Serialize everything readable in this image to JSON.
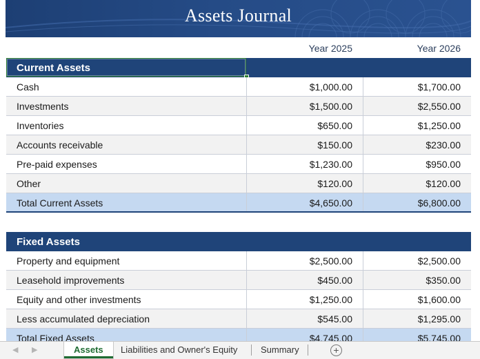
{
  "banner": {
    "title": "Assets Journal"
  },
  "columns": {
    "year1": "Year 2025",
    "year2": "Year 2026"
  },
  "current_assets": {
    "header": "Current Assets",
    "rows": [
      {
        "label": "Cash",
        "y1": "$1,000.00",
        "y2": "$1,700.00"
      },
      {
        "label": "Investments",
        "y1": "$1,500.00",
        "y2": "$2,550.00"
      },
      {
        "label": "Inventories",
        "y1": "$650.00",
        "y2": "$1,250.00"
      },
      {
        "label": "Accounts receivable",
        "y1": "$150.00",
        "y2": "$230.00"
      },
      {
        "label": "Pre-paid expenses",
        "y1": "$1,230.00",
        "y2": "$950.00"
      },
      {
        "label": "Other",
        "y1": "$120.00",
        "y2": "$120.00"
      }
    ],
    "total": {
      "label": "Total Current Assets",
      "y1": "$4,650.00",
      "y2": "$6,800.00"
    }
  },
  "fixed_assets": {
    "header": "Fixed Assets",
    "rows": [
      {
        "label": "Property and equipment",
        "y1": "$2,500.00",
        "y2": "$2,500.00"
      },
      {
        "label": "Leasehold improvements",
        "y1": "$450.00",
        "y2": "$350.00"
      },
      {
        "label": "Equity and other investments",
        "y1": "$1,250.00",
        "y2": "$1,600.00"
      },
      {
        "label": "Less accumulated depreciation",
        "y1": "$545.00",
        "y2": "$1,295.00"
      }
    ],
    "total": {
      "label": "Total Fixed Assets",
      "y1": "$4,745.00",
      "y2": "$5,745.00"
    }
  },
  "sheet_tabs": {
    "prev_icon": "triangle-left-icon",
    "next_icon": "triangle-right-icon",
    "tabs": [
      {
        "label": "Assets",
        "active": true
      },
      {
        "label": "Liabilities and Owner's Equity",
        "active": false
      },
      {
        "label": "Summary",
        "active": false
      }
    ],
    "add_icon": "plus-circle-icon"
  },
  "colors": {
    "header_blue": "#1f4479",
    "total_fill": "#c5d9f1",
    "active_tab": "#1e6b32"
  }
}
